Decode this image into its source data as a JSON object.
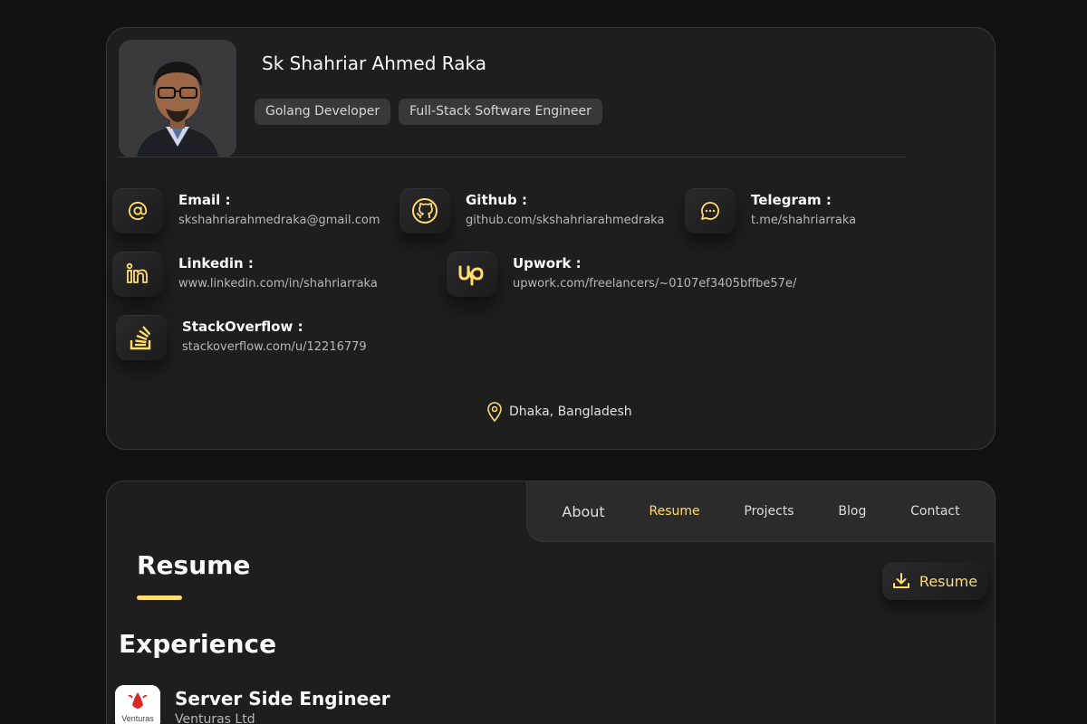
{
  "profile": {
    "name": "Sk Shahriar Ahmed Raka",
    "tags": [
      "Golang Developer",
      "Full-Stack Software Engineer"
    ],
    "contacts": {
      "email": {
        "title": "Email :",
        "value": "skshahriarahmedraka@gmail.com",
        "icon": "at-icon"
      },
      "github": {
        "title": "Github :",
        "value": "github.com/skshahriarahmedraka",
        "icon": "github-icon"
      },
      "telegram": {
        "title": "Telegram :",
        "value": "t.me/shahriarraka",
        "icon": "chat-icon"
      },
      "linkedin": {
        "title": "Linkedin :",
        "value": "www.linkedin.com/in/shahriarraka",
        "icon": "linkedin-icon"
      },
      "upwork": {
        "title": "Upwork :",
        "value": "upwork.com/freelancers/~0107ef3405bffbe57e/",
        "icon": "upwork-icon"
      },
      "stackoverflow": {
        "title": "StackOverflow :",
        "value": "stackoverflow.com/u/12216779",
        "icon": "stackoverflow-icon"
      }
    },
    "location": "Dhaka, Bangladesh"
  },
  "nav": {
    "items": [
      "About",
      "Resume",
      "Projects",
      "Blog",
      "Contact"
    ],
    "active": "Resume"
  },
  "main": {
    "section_title": "Resume",
    "download_label": "Resume",
    "experience_title": "Experience",
    "jobs": [
      {
        "title": "Server Side Engineer",
        "company": "Venturas Ltd",
        "logo_text": "Venturas"
      }
    ]
  },
  "colors": {
    "accent": "#ffdb70",
    "background": "#121212",
    "card": "#1e1e1f"
  }
}
